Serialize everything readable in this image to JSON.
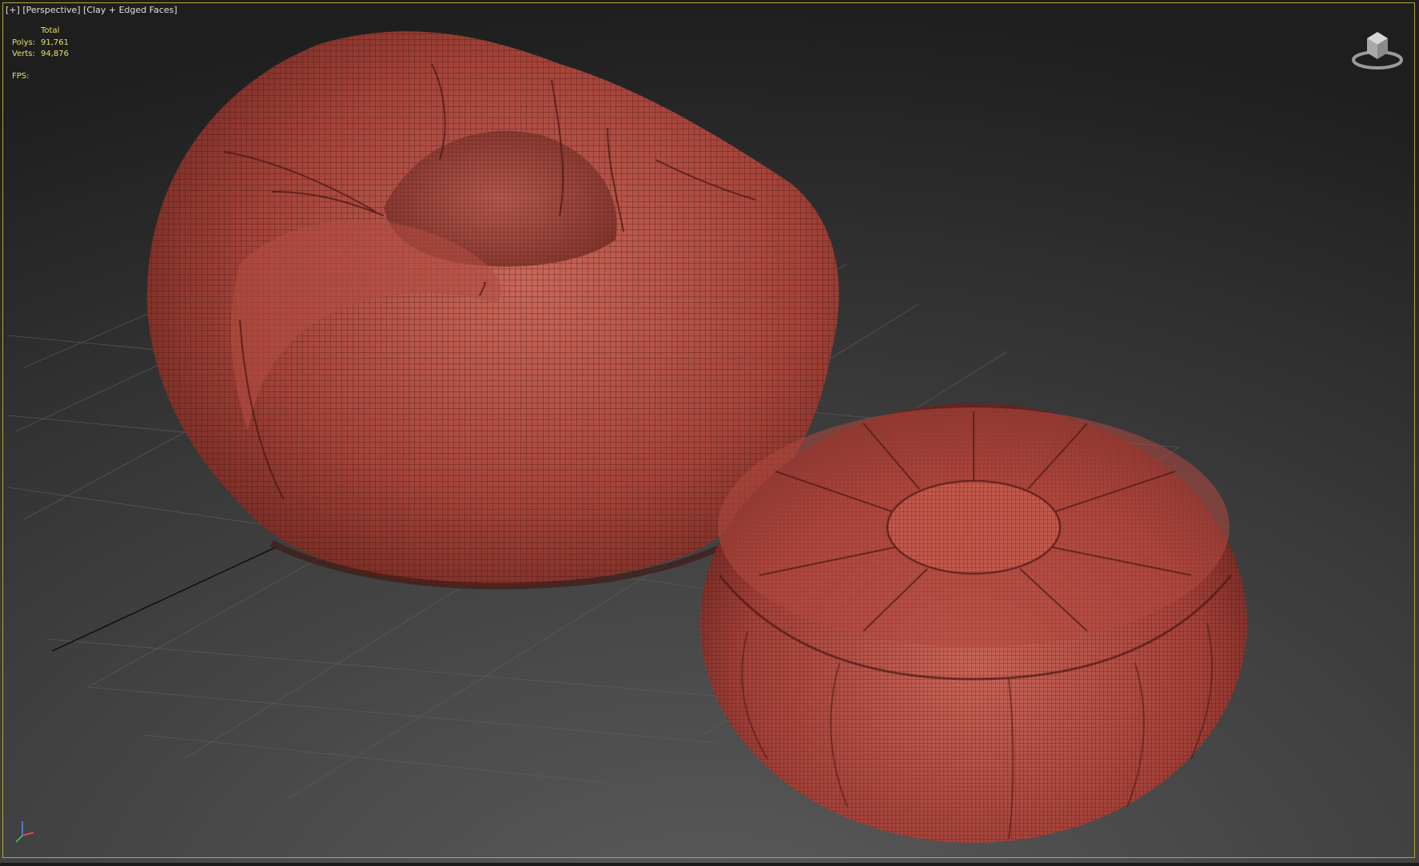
{
  "viewport": {
    "label_plus": "[+]",
    "label_view": "[Perspective]",
    "label_shading": "[Clay + Edged Faces]",
    "frame_color": "#b8a53f"
  },
  "stats": {
    "column_header": "Total",
    "polys_label": "Polys:",
    "polys_value": "91,761",
    "verts_label": "Verts:",
    "verts_value": "94,876",
    "fps_label": "FPS:",
    "text_color": "#e8e26a"
  },
  "scene": {
    "objects": [
      "bean-bag-chair",
      "round-pouf-ottoman"
    ],
    "mesh_color": "#b5473b",
    "wire_color": "#3a1410",
    "grid_color": "#5a5a5a"
  },
  "icons": {
    "viewcube": "viewcube-icon",
    "axis": "axis-tripod-icon"
  }
}
